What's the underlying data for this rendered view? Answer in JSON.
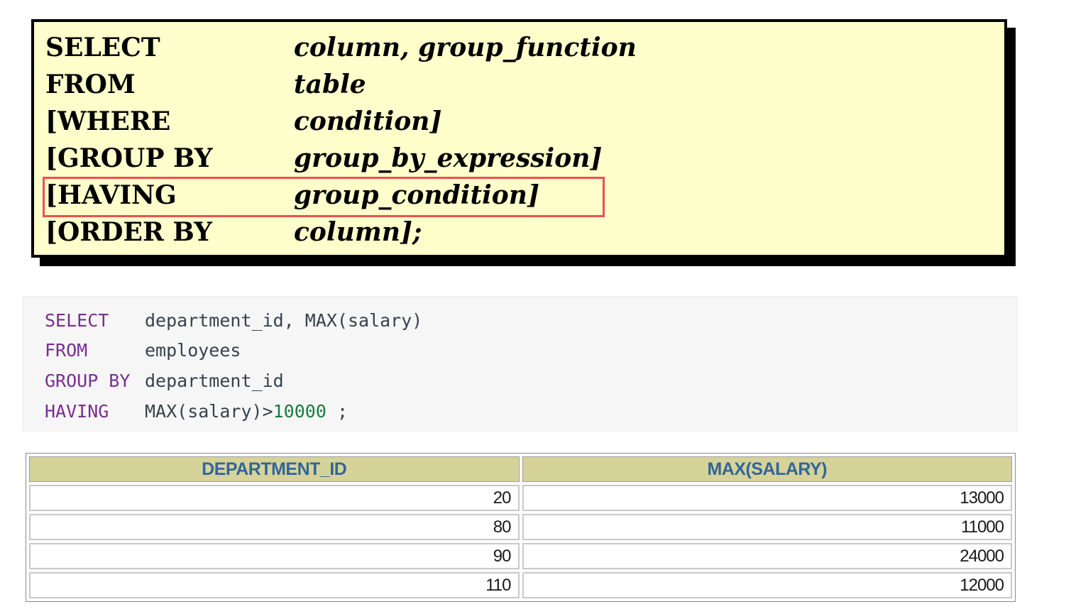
{
  "syntax": {
    "lines": [
      {
        "keyword": "SELECT",
        "argument": "column, group_function"
      },
      {
        "keyword": "FROM",
        "argument": "table"
      },
      {
        "keyword": "[WHERE",
        "argument": "condition]"
      },
      {
        "keyword": "[GROUP BY",
        "argument": "group_by_expression]"
      },
      {
        "keyword": "[HAVING",
        "argument": "group_condition]"
      },
      {
        "keyword": "[ORDER BY",
        "argument": "column];"
      }
    ],
    "highlight_color": "#e8524f",
    "background_color": "#ffffcc"
  },
  "code": {
    "lines": [
      {
        "keyword": "SELECT",
        "rest": "department_id, MAX(salary)"
      },
      {
        "keyword": "FROM",
        "rest": "employees"
      },
      {
        "keyword": "GROUP BY",
        "rest": "department_id"
      },
      {
        "keyword": "HAVING",
        "rest_before": "MAX(salary)>",
        "number": "10000",
        "rest_after": " ;"
      }
    ],
    "keyword_color": "#7a2e8f",
    "number_color": "#1a7a3c"
  },
  "result": {
    "columns": [
      "DEPARTMENT_ID",
      "MAX(SALARY)"
    ],
    "rows": [
      [
        "20",
        "13000"
      ],
      [
        "80",
        "11000"
      ],
      [
        "90",
        "24000"
      ],
      [
        "110",
        "12000"
      ]
    ],
    "header_color": "#d6d39a",
    "header_text_color": "#336699"
  }
}
